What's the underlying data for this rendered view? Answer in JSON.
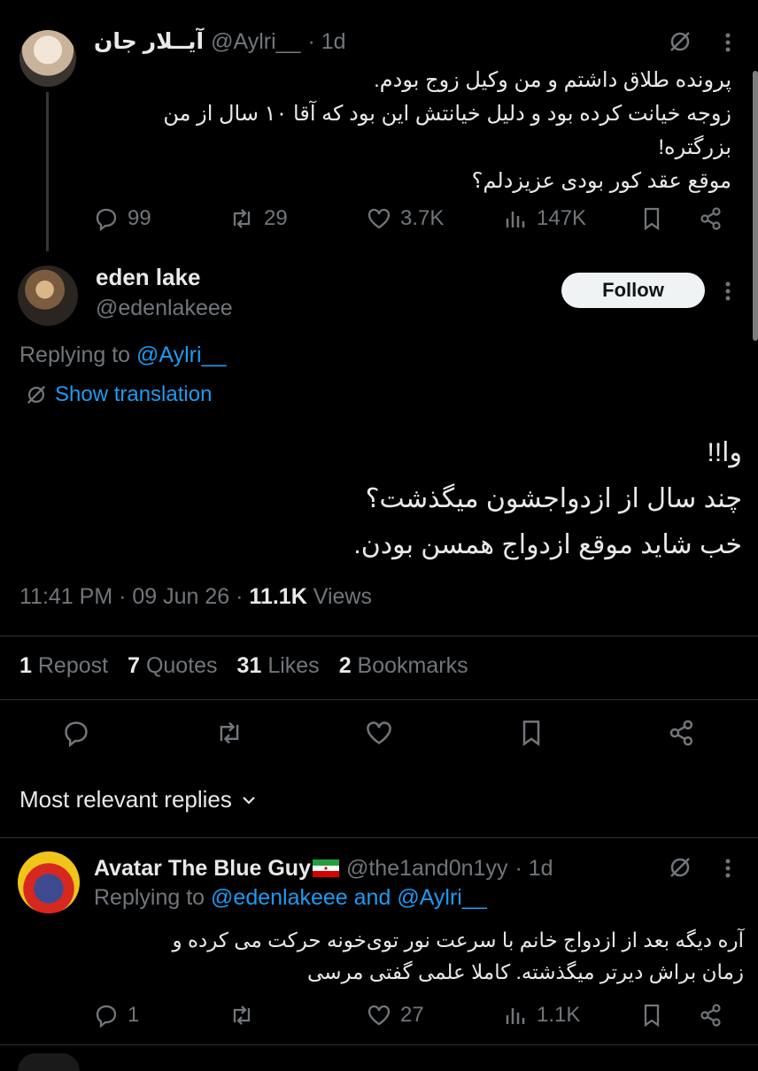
{
  "tweet1": {
    "display_name": "آیــلار جان",
    "handle": "@Aylri__",
    "time": "· 1d",
    "lines": [
      "پرونده طلاق داشتم و من وکیل زوج بودم.",
      "زوجه خیانت کرده بود و دلیل خیانتش این بود که آقا ۱۰ سال از من",
      "بزرگتره!",
      "موقع عقد کور بودی عزیزدلم؟"
    ],
    "stats": {
      "replies": "99",
      "reposts": "29",
      "likes": "3.7K",
      "views": "147K"
    }
  },
  "main_tweet": {
    "display_name": "eden lake",
    "handle": "@edenlakeee",
    "follow_label": "Follow",
    "replying_prefix": "Replying to",
    "replying_to": "@Aylri__",
    "show_translation": "Show translation",
    "lines": [
      "وا!!",
      "چند سال از ازدواجشون میگذشت؟",
      "خب شاید موقع ازدواج همسن بودن."
    ],
    "meta_time": "11:41 PM · 09 Jun 26 ·",
    "meta_views_count": "11.1K",
    "meta_views_label": "Views",
    "counts": [
      {
        "num": "1",
        "label": "Repost"
      },
      {
        "num": "7",
        "label": "Quotes"
      },
      {
        "num": "31",
        "label": "Likes"
      },
      {
        "num": "2",
        "label": "Bookmarks"
      }
    ]
  },
  "sort": {
    "label": "Most relevant replies"
  },
  "reply1": {
    "display_name": "Avatar The Blue Guy",
    "handle": "@the1and0n1yy",
    "time": "· 1d",
    "replying_prefix": "Replying to",
    "replying_to_1": "@edenlakeee",
    "replying_and": "and",
    "replying_to_2": "@Aylri__",
    "lines": [
      "آره دیگه بعد از ازدواج  خانم با سرعت نور توی‌خونه حرکت می کرده و",
      "زمان براش دیرتر میگذشته. کاملا علمی گفتی مرسی"
    ],
    "stats": {
      "replies": "1",
      "reposts": "",
      "likes": "27",
      "views": "1.1K"
    }
  },
  "colors": {
    "background": "#000000",
    "text": "#e7e9ea",
    "muted": "#71767b",
    "link": "#1d9bf0",
    "divider": "#2f3336"
  }
}
